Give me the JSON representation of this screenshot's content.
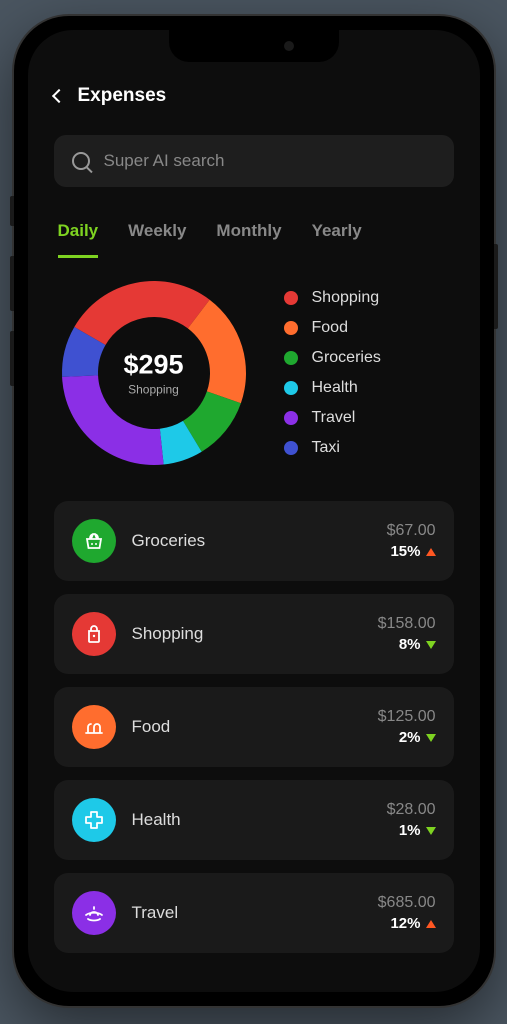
{
  "header": {
    "title": "Expenses"
  },
  "search": {
    "placeholder": "Super AI search"
  },
  "tabs": [
    {
      "label": "Daily",
      "active": true
    },
    {
      "label": "Weekly",
      "active": false
    },
    {
      "label": "Monthly",
      "active": false
    },
    {
      "label": "Yearly",
      "active": false
    }
  ],
  "chart_data": {
    "type": "pie",
    "title": "",
    "center_amount": "$295",
    "center_label": "Shopping",
    "series": [
      {
        "name": "Shopping",
        "value": 27,
        "color": "#e53935"
      },
      {
        "name": "Food",
        "value": 20,
        "color": "#ff6d2e"
      },
      {
        "name": "Groceries",
        "value": 11,
        "color": "#1fa82f"
      },
      {
        "name": "Health",
        "value": 7,
        "color": "#1ec9e8"
      },
      {
        "name": "Travel",
        "value": 26,
        "color": "#8b2fe6"
      },
      {
        "name": "Taxi",
        "value": 9,
        "color": "#3f51d1"
      }
    ],
    "legend_order": [
      "Shopping",
      "Food",
      "Groceries",
      "Health",
      "Travel",
      "Taxi"
    ]
  },
  "categories": [
    {
      "name": "Groceries",
      "amount": "$67.00",
      "change": "15%",
      "direction": "up",
      "color": "#1fa82f",
      "icon": "basket"
    },
    {
      "name": "Shopping",
      "amount": "$158.00",
      "change": "8%",
      "direction": "down",
      "color": "#e53935",
      "icon": "bag"
    },
    {
      "name": "Food",
      "amount": "$125.00",
      "change": "2%",
      "direction": "down",
      "color": "#ff6d2e",
      "icon": "food"
    },
    {
      "name": "Health",
      "amount": "$28.00",
      "change": "1%",
      "direction": "down",
      "color": "#1ec9e8",
      "icon": "health"
    },
    {
      "name": "Travel",
      "amount": "$685.00",
      "change": "12%",
      "direction": "up",
      "color": "#8b2fe6",
      "icon": "travel"
    }
  ],
  "colors": {
    "up": "#ff5722",
    "down": "#7ed321",
    "accent": "#7ed321"
  }
}
